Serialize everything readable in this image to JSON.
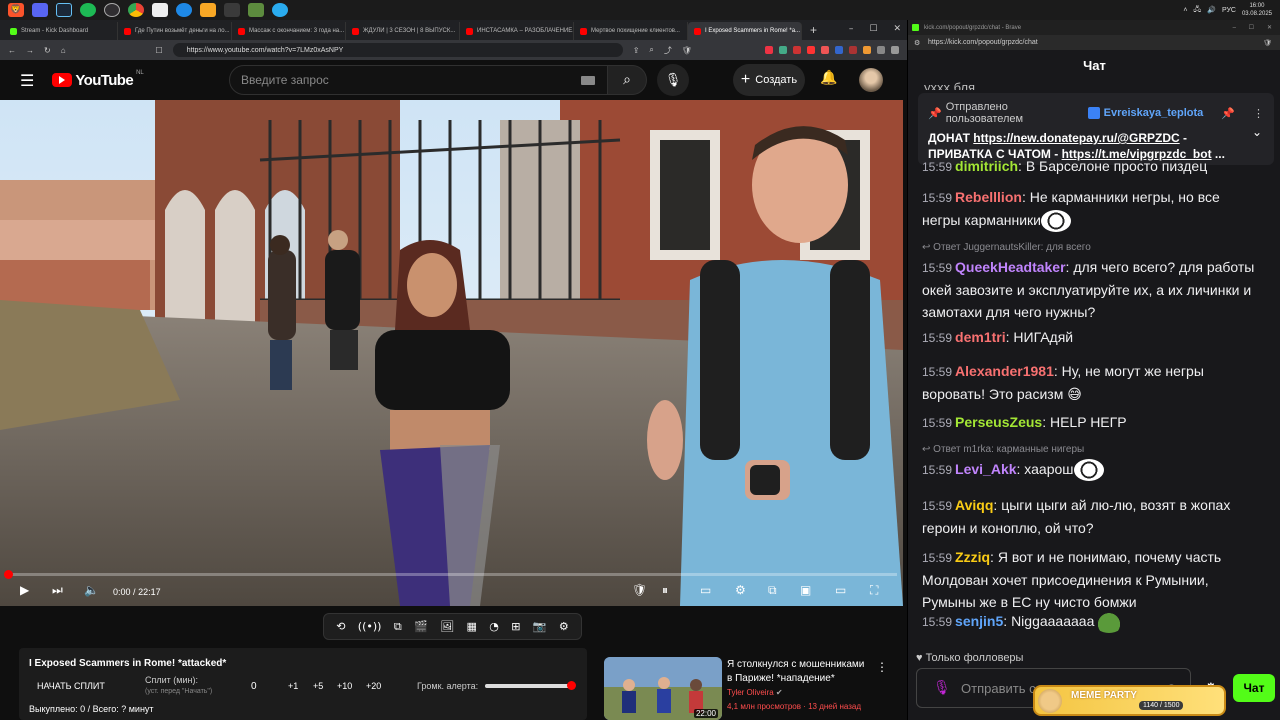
{
  "taskbar": {
    "tray_lang": "РУС",
    "time": "16:00",
    "date": "03.08.2025"
  },
  "browser_left": {
    "tabs": [
      {
        "label": "Stream - Kick Dashboard",
        "color": "#53fc18"
      },
      {
        "label": "Где Путин возьмёт деньги на ло...",
        "color": "#ff0000"
      },
      {
        "label": "Массаж с окончанием: 3 года на...",
        "color": "#ff0000"
      },
      {
        "label": "ЖДУЛИ | 3 СЕЗОН | 8 ВЫПУСК...",
        "color": "#ff0000"
      },
      {
        "label": "ИНСТАСАМКА – РАЗОБЛАЧЕНИЕ...",
        "color": "#ff0000"
      },
      {
        "label": "Мертвое похищение клиентов...",
        "color": "#ff0000"
      },
      {
        "label": "I Exposed Scammers in Rome! *a...",
        "color": "#ff0000",
        "active": true
      }
    ],
    "url": "https://www.youtube.com/watch?v=7LMz0xAsNPY"
  },
  "youtube": {
    "logo_text": "YouTube",
    "region": "NL",
    "search_placeholder": "Введите запрос",
    "create_label": "Создать",
    "player": {
      "time_current": "0:00",
      "time_total": "22:17",
      "progress": 0.0
    },
    "split_panel": {
      "title": "I Exposed Scammers in Rome! *attacked*",
      "start_button": "НАЧАТЬ СПЛИТ",
      "split_label": "Сплит (мин):",
      "split_hint": "(уст. перед \"Начать\")",
      "split_value": "0",
      "increments": [
        "+1",
        "+5",
        "+10",
        "+20"
      ],
      "alert_label": "Громк. алерта:",
      "alert_volume": 0.98,
      "bought_text": "Выкуплено: 0 / Всего: ? минут"
    },
    "recommendation": {
      "title_line1": "Я столкнулся с мошенниками",
      "title_line2": "в Париже! *нападение*",
      "channel": "Tyler Oliveira",
      "views": "4,1 млн просмотров",
      "age": "13 дней назад",
      "duration": "22:00"
    }
  },
  "kick": {
    "window_title": "kick.com/popout/grpzdc/chat - Brave",
    "url": "https://kick.com/popout/grpzdc/chat",
    "chat_header": "Чат",
    "scrolled_text": "уххх бля",
    "pinned": {
      "label": "Отправлено пользователем",
      "user": "Evreiskaya_teplota",
      "line1_prefix": "ДОНАТ ",
      "line1_link": "https://new.donatepay.ru/@GRPZDC",
      "line1_suffix": " -",
      "line2_prefix": "ПРИВАТКА С ЧАТОМ - ",
      "line2_link": "https://t.me/vipgrpzdc_bot",
      "line2_suffix": " ..."
    },
    "messages": [
      {
        "time": "15:59",
        "user": "dimitriich",
        "color": "#a3e635",
        "text": "В Барселоне просто пиздец"
      },
      {
        "time": "15:59",
        "user": "Rebelllion",
        "color": "#f87171",
        "text": "Не карманники негры, но все негры карманники"
      },
      {
        "time": "15:59",
        "user": "QueekHeadtaker",
        "color": "#c084fc",
        "text": "для чего всего? для работы окей завозите и эксплуатируйте их, а их личинки и замотахи для чего нужны?",
        "reply": "Ответ JuggernautsKiller: для всего"
      },
      {
        "time": "15:59",
        "user": "dem1tri",
        "color": "#f87171",
        "text": "НИГАдяй"
      },
      {
        "time": "15:59",
        "user": "Alexander1981",
        "color": "#f87171",
        "text": "Ну, не могут же негры воровать! Это расизм 😅"
      },
      {
        "time": "15:59",
        "user": "PerseusZeus",
        "color": "#a3e635",
        "text": "HELP НЕГР"
      },
      {
        "time": "15:59",
        "user": "Levi_Akk",
        "color": "#c084fc",
        "text": "хаарош",
        "reply": "Ответ m1rka: карманные нигеры"
      },
      {
        "time": "15:59",
        "user": "Aviqq",
        "color": "#facc15",
        "text": "цыги цыги ай лю-лю, возят в жопах героин и коноплю, ой что?"
      },
      {
        "time": "15:59",
        "user": "Zzziq",
        "color": "#facc15",
        "text": "Я вот и не понимаю, почему часть Молдован хочет присоединения к Румынии, Румыны же в ЕС ну чисто бомжи"
      },
      {
        "time": "15:59",
        "user": "senjin5",
        "color": "#60a5fa",
        "text": "Niggaaaaaaa"
      }
    ],
    "followers_only": "Только фолловеры",
    "input_placeholder": "Отправить со",
    "chat_button": "Чат",
    "meme_party": {
      "label": "MEME PARTY",
      "progress_text": "1140 / 1500"
    }
  }
}
